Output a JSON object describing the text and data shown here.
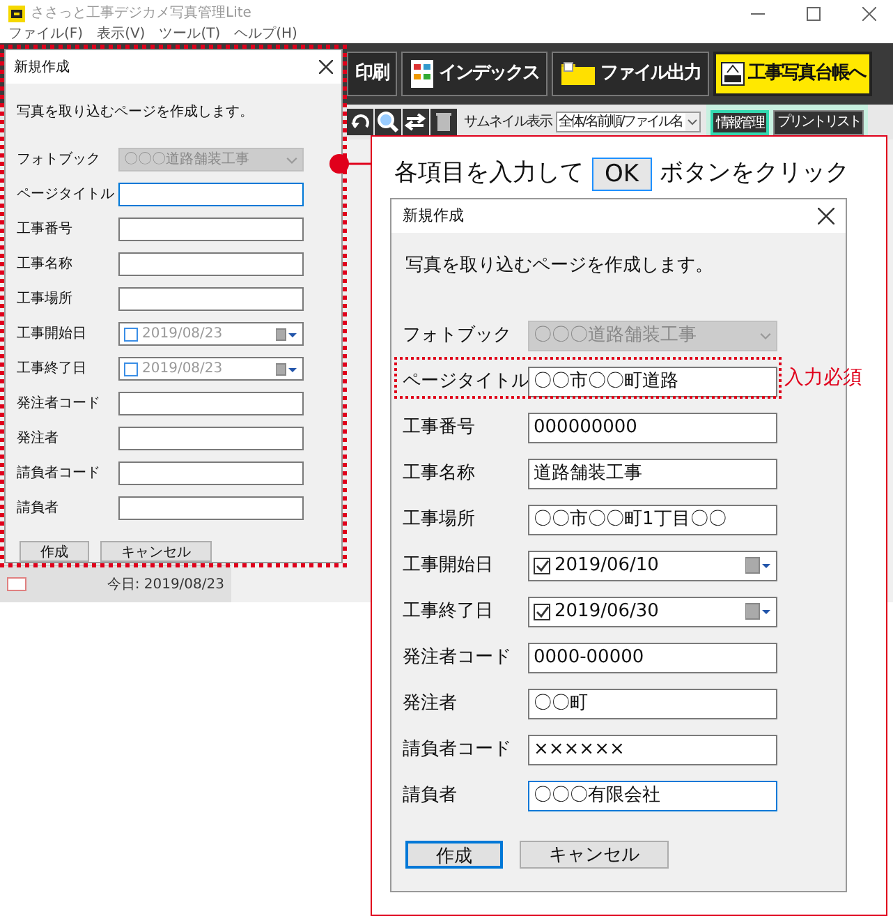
{
  "app": {
    "title": "ささっと工事デジカメ写真管理Lite",
    "menu": [
      "ファイル(F)",
      "表示(V)",
      "ツール(T)",
      "ヘルプ(H)"
    ],
    "toolbar_buttons": [
      {
        "label": "印刷",
        "kind": "dark"
      },
      {
        "label": "インデックス",
        "kind": "dark"
      },
      {
        "label": "ファイル出力",
        "kind": "dark"
      },
      {
        "label": "工事写真台帳へ",
        "kind": "highlight"
      }
    ],
    "thumbnail_label": "サムネイル表示",
    "thumbnail_select": "全体/名前順/ファイル名",
    "side_tabs": [
      {
        "label": "情報管理",
        "selected": true
      },
      {
        "label": "プリントリスト",
        "selected": false
      }
    ],
    "today": "今日: 2019/08/23"
  },
  "small_dialog": {
    "title": "新規作成",
    "message": "写真を取り込むページを作成します。",
    "fields": [
      {
        "label": "フォトブック",
        "kind": "select",
        "value": "〇〇〇道路舗装工事",
        "disabled": true
      },
      {
        "label": "ページタイトル",
        "kind": "text",
        "focused": true
      },
      {
        "label": "工事番号",
        "kind": "text"
      },
      {
        "label": "工事名称",
        "kind": "text"
      },
      {
        "label": "工事場所",
        "kind": "text"
      },
      {
        "label": "工事開始日",
        "kind": "date",
        "value": "2019/08/23",
        "checked": false
      },
      {
        "label": "工事終了日",
        "kind": "date",
        "value": "2019/08/23",
        "checked": false
      },
      {
        "label": "発注者コード",
        "kind": "text"
      },
      {
        "label": "発注者",
        "kind": "text"
      },
      {
        "label": "請負者コード",
        "kind": "text"
      },
      {
        "label": "請負者",
        "kind": "text"
      }
    ],
    "buttons": [
      {
        "label": "作成",
        "default": false
      },
      {
        "label": "キャンセル",
        "default": false
      }
    ]
  },
  "callout": {
    "before": "各項目を入力して",
    "key": "OK",
    "after": "ボタンをクリック",
    "required_note": "入力必須"
  },
  "large_dialog": {
    "title": "新規作成",
    "message": "写真を取り込むページを作成します。",
    "fields": [
      {
        "label": "フォトブック",
        "kind": "select",
        "value": "〇〇〇道路舗装工事",
        "disabled": true
      },
      {
        "label": "ページタイトル",
        "kind": "text",
        "value": "〇〇市〇〇町道路",
        "required": true
      },
      {
        "label": "工事番号",
        "kind": "text",
        "value": "000000000"
      },
      {
        "label": "工事名称",
        "kind": "text",
        "value": "道路舗装工事"
      },
      {
        "label": "工事場所",
        "kind": "text",
        "value": "〇〇市〇〇町1丁目〇〇"
      },
      {
        "label": "工事開始日",
        "kind": "date",
        "value": "2019/06/10",
        "checked": true
      },
      {
        "label": "工事終了日",
        "kind": "date",
        "value": "2019/06/30",
        "checked": true
      },
      {
        "label": "発注者コード",
        "kind": "text",
        "value": "0000-00000"
      },
      {
        "label": "発注者",
        "kind": "text",
        "value": "〇〇町"
      },
      {
        "label": "請負者コード",
        "kind": "text",
        "value": "××××××"
      },
      {
        "label": "請負者",
        "kind": "text",
        "value": "〇〇〇有限会社",
        "focused": true
      }
    ],
    "buttons": [
      {
        "label": "作成",
        "default": true
      },
      {
        "label": "キャンセル",
        "default": false
      }
    ]
  }
}
